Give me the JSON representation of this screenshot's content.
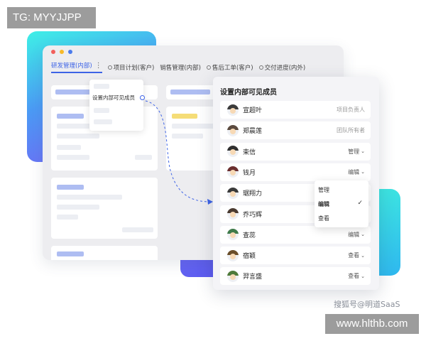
{
  "watermark_top": "TG: MYYJJPP",
  "watermark_bottom": "www.hlthb.com",
  "credit": "搜狐号@明道SaaS",
  "window": {
    "tabs": [
      {
        "label": "研发管理(内部)",
        "active": true
      },
      {
        "label": "项目计划(客户)",
        "active": false
      },
      {
        "label": "销售管理(内部)",
        "active": false
      },
      {
        "label": "售后工单(客户)",
        "active": false
      },
      {
        "label": "交付进度(内外)",
        "active": false
      }
    ]
  },
  "context_menu": {
    "label": "设置内部可见成员"
  },
  "panel": {
    "title": "设置内部可见成员",
    "members": [
      {
        "name": "宣超叶",
        "role": "项目负责人",
        "editable": false,
        "hair": "#3b3b3b"
      },
      {
        "name": "郑晨莲",
        "role": "团队所有者",
        "editable": false,
        "hair": "#5b4a3f"
      },
      {
        "name": "束信",
        "role": "管理",
        "editable": true,
        "hair": "#2f2f2f"
      },
      {
        "name": "钱月",
        "role": "编辑",
        "editable": true,
        "hair": "#6b2f2f"
      },
      {
        "name": "琚翔力",
        "role": "",
        "editable": false,
        "hair": "#3a3a3a"
      },
      {
        "name": "乔巧辉",
        "role": "",
        "editable": false,
        "hair": "#4a3a30"
      },
      {
        "name": "查蕊",
        "role": "编辑",
        "editable": true,
        "hair": "#3f7a4a"
      },
      {
        "name": "宿颖",
        "role": "查看",
        "editable": true,
        "hair": "#6a4e2a"
      },
      {
        "name": "羿言盛",
        "role": "查看",
        "editable": true,
        "hair": "#4f7a3a"
      }
    ],
    "dropdown": {
      "options": [
        "管理",
        "编辑",
        "查看"
      ],
      "selected": "编辑"
    }
  },
  "colors": {
    "accent": "#3d63e6",
    "dot_red": "#f25f5c",
    "dot_yellow": "#f7b928",
    "dot_blue": "#4b7bec"
  }
}
